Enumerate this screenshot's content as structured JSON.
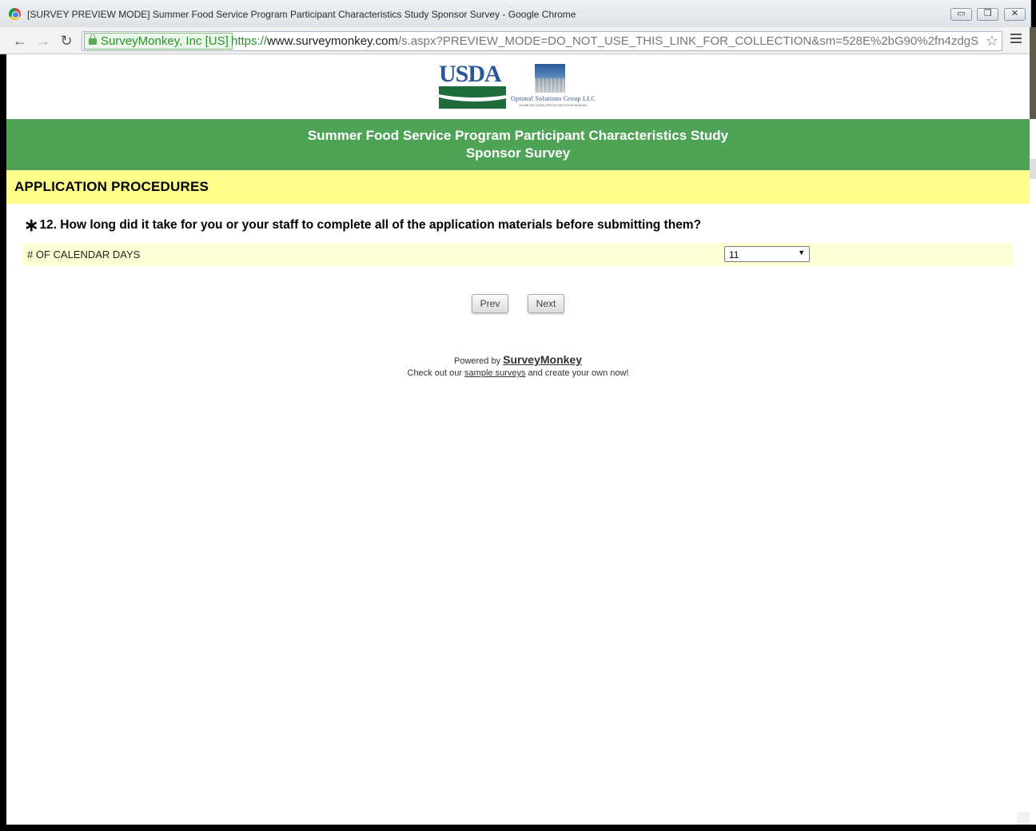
{
  "window": {
    "title": "[SURVEY PREVIEW MODE] Summer Food Service Program Participant Characteristics Study Sponsor Survey - Google Chrome",
    "min_glyph": "▭",
    "max_glyph": "❐",
    "close_glyph": "✕"
  },
  "toolbar": {
    "back_glyph": "←",
    "forward_glyph": "→",
    "reload_glyph": "↻",
    "ev_label": "SurveyMonkey, Inc [US]",
    "url_scheme": "https://",
    "url_host": "www.surveymonkey.com",
    "url_path": "/s.aspx?PREVIEW_MODE=DO_NOT_USE_THIS_LINK_FOR_COLLECTION&sm=528E%2bG90%2fn4zdgS",
    "star_glyph": "☆"
  },
  "logos": {
    "usda": "USDA",
    "osg_name": "Optimal Solutions Group LLC",
    "osg_tagline": "ENABLING DATA-DRIVEN DECISION MAKING"
  },
  "banner": {
    "line1": "Summer Food Service Program Participant Characteristics Study",
    "line2": "Sponsor Survey"
  },
  "section": {
    "title": "APPLICATION PROCEDURES"
  },
  "question": {
    "required_mark": "∗",
    "text": "12. How long did it take for you or your staff to complete all of the application materials before submitting them?",
    "row_label": "# OF CALENDAR DAYS",
    "selected_value": "11",
    "select_glyph": "▼"
  },
  "nav": {
    "prev_label": "Prev",
    "next_label": "Next"
  },
  "footer": {
    "powered_prefix": "Powered by ",
    "powered_brand": "SurveyMonkey",
    "checkout_prefix": "Check out our ",
    "checkout_link": "sample surveys",
    "checkout_suffix": " and create your own now!"
  },
  "colors": {
    "banner_green": "#4ea356",
    "section_yellow": "#fffe8a",
    "answer_row": "#ffffd6",
    "usda_blue": "#2c5697",
    "usda_green": "#1f6b3c"
  }
}
